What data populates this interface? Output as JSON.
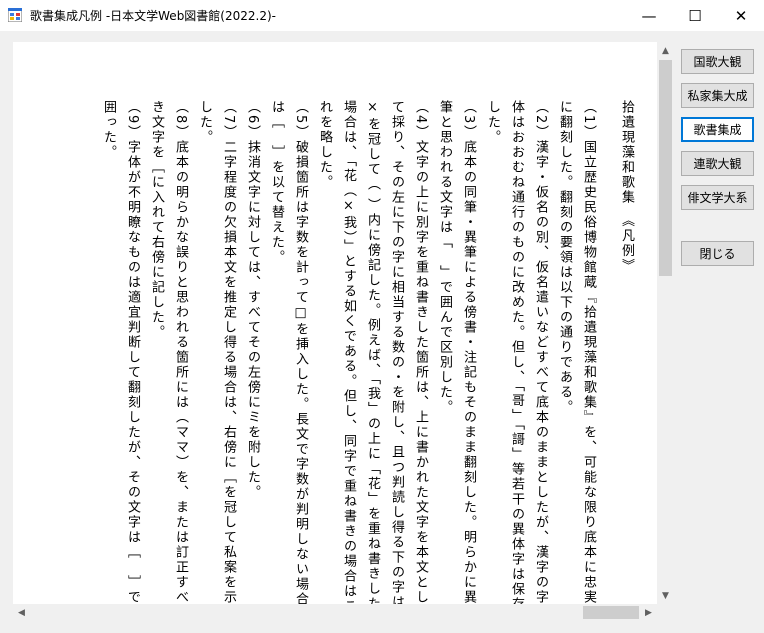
{
  "window": {
    "title": "歌書集成凡例  -日本文学Web図書館(2022.2)-",
    "minimize": "—",
    "maximize": "☐",
    "close": "✕"
  },
  "document": {
    "heading": "拾遺現藻和歌集　《凡例》",
    "items": [
      "（1）国立歴史民俗博物館蔵『拾遺現藻和歌集』を、可能な限り底本に忠実に翻刻した。翻刻の要領は以下の通りである。",
      "（2）漢字・仮名の別、仮名遣いなどすべて底本のままとしたが、漢字の字体はおおむね通行のものに改めた。但し、「哥」「謌」等若干の異体字は保存した。",
      "（3）底本の同筆・異筆による傍書・注記もそのまま翻刻した。明らかに異筆と思われる文字は「　」で囲んで区別した。",
      "（4）文字の上に別字を重ね書きした箇所は、上に書かれた文字を本文として採り、その左に下の字に相当する数の・を附し、且つ判読し得る下の字は×を冠して（ ）内に傍記した。例えば、「我」の上に「花」を重ね書きした場合は、「花（×我）」とする如くである。但し、同字で重ね書きの場合はこれを略した。",
      "（5）破損箇所は字数を計って□を挿入した。長文で字数が判明しない場合は［　］を以て替えた。",
      "（6）抹消文字に対しては、すべてその左傍にミを附した。",
      "（7）二字程度の欠損本文を推定し得る場合は、右傍に［を冠して私案を示した。",
      "（8）底本の明らかな誤りと思われる箇所には（ママ）を、または訂正すべき文字を［に入れて右傍に記した。",
      "（9）字体が不明瞭なものは適宜判断して翻刻したが、その文字は［　］で囲った。"
    ]
  },
  "sidebar": {
    "buttons": [
      {
        "label": "国歌大観"
      },
      {
        "label": "私家集大成"
      },
      {
        "label": "歌書集成"
      },
      {
        "label": "連歌大観"
      },
      {
        "label": "俳文学大系"
      }
    ],
    "close_label": "閉じる"
  },
  "scroll": {
    "up": "▲",
    "down": "▼",
    "left": "◀",
    "right": "▶"
  }
}
